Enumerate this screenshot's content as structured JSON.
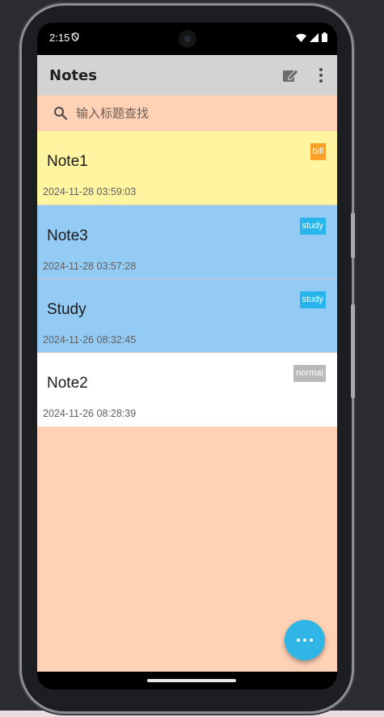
{
  "status_bar": {
    "time": "2:15"
  },
  "app_bar": {
    "title": "Notes"
  },
  "search": {
    "placeholder": "输入标题查找",
    "value": ""
  },
  "notes": [
    {
      "title": "Note1",
      "timestamp": "2024-11-28 03:59:03",
      "tag": "bill",
      "bg_color": "#fff49f",
      "tag_color": "#f8a028"
    },
    {
      "title": "Note3",
      "timestamp": "2024-11-28 03:57:28",
      "tag": "study",
      "bg_color": "#93cbf5",
      "tag_color": "#27b5eb"
    },
    {
      "title": "Study",
      "timestamp": "2024-11-26 08:32:45",
      "tag": "study",
      "bg_color": "#93cbf5",
      "tag_color": "#27b5eb"
    },
    {
      "title": "Note2",
      "timestamp": "2024-11-26 08:28:39",
      "tag": "normal",
      "bg_color": "#ffffff",
      "tag_color": "#b9b9b9"
    }
  ],
  "colors": {
    "list_background": "#ffd1b5",
    "app_bar": "#d3d3d3",
    "fab": "#2fb6e7"
  },
  "icons": {
    "status": [
      "shield-icon",
      "wifi-icon",
      "signal-icon",
      "battery-icon"
    ],
    "app_bar": [
      "edit-note-icon",
      "more-vert-icon"
    ],
    "search": "search-icon",
    "fab": "more-horiz-icon"
  }
}
